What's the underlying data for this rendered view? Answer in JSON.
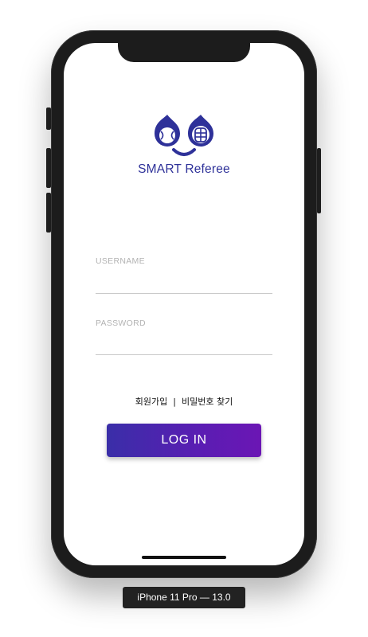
{
  "app": {
    "brand_name": "SMART Referee",
    "brand_color": "#2e3199"
  },
  "login_form": {
    "username_label": "USERNAME",
    "password_label": "PASSWORD",
    "username_value": "",
    "password_value": "",
    "signup_link": "회원가입",
    "separator": "|",
    "find_password_link": "비밀번호 찾기",
    "login_button": "LOG IN",
    "button_gradient": [
      "#3a2ea8",
      "#6b16b4"
    ]
  },
  "device": {
    "caption": "iPhone 11 Pro — 13.0"
  },
  "icons": {
    "logo": "smart-referee-logo-icon"
  }
}
